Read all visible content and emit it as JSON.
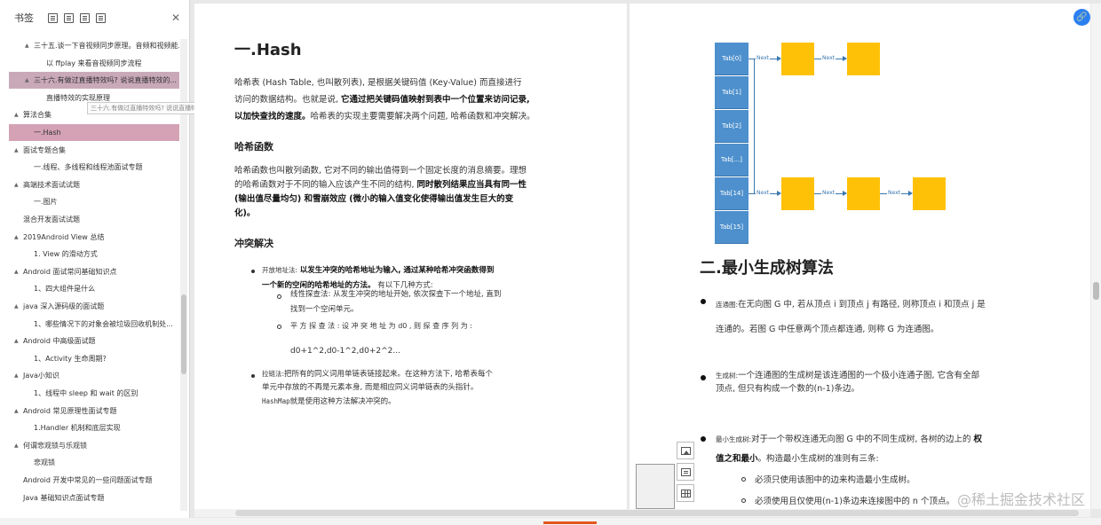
{
  "sidebar": {
    "title": "书签",
    "tooltip": "三十六.有做过直播特效吗? 说说直播特效的实现原",
    "items": [
      {
        "label": "三十五.谈一下音视频同步原理。音频和视频能...",
        "level": 1,
        "twisty": "▲"
      },
      {
        "label": "以 ffplay 来看音视频同步流程",
        "level": 3,
        "twisty": ""
      },
      {
        "label": "三十六.有做过直播特效吗? 说说直播特效的...",
        "level": 1,
        "twisty": "▲"
      },
      {
        "label": "直播特效的实现原理",
        "level": 3,
        "twisty": ""
      },
      {
        "label": "算法合集",
        "level": 0,
        "twisty": "▲"
      },
      {
        "label": "一.Hash",
        "level": 2,
        "twisty": ""
      },
      {
        "label": "面试专题合集",
        "level": 0,
        "twisty": "▲"
      },
      {
        "label": "一.线程、多线程和线程池面试专题",
        "level": 2,
        "twisty": ""
      },
      {
        "label": "高端技术面试试题",
        "level": 0,
        "twisty": "▲"
      },
      {
        "label": "一.图片",
        "level": 2,
        "twisty": ""
      },
      {
        "label": "混合开发面试试题",
        "level": 0,
        "twisty": ""
      },
      {
        "label": "2019Android View 总结",
        "level": 0,
        "twisty": "▲"
      },
      {
        "label": "1. View 的滑动方式",
        "level": 2,
        "twisty": ""
      },
      {
        "label": "Android 面试常问基础知识点",
        "level": 0,
        "twisty": "▲"
      },
      {
        "label": "1、四大组件是什么",
        "level": 2,
        "twisty": ""
      },
      {
        "label": "java 深入源码级的面试题",
        "level": 0,
        "twisty": "▲"
      },
      {
        "label": "1、哪些情况下的对象会被垃圾回收机制处...",
        "level": 2,
        "twisty": ""
      },
      {
        "label": "Android 中高级面试题",
        "level": 0,
        "twisty": "▲"
      },
      {
        "label": "1、Activity 生命周期?",
        "level": 2,
        "twisty": ""
      },
      {
        "label": "Java小知识",
        "level": 0,
        "twisty": "▲"
      },
      {
        "label": "1、线程中 sleep 和 wait 的区别",
        "level": 2,
        "twisty": ""
      },
      {
        "label": "Android 常见原理性面试专题",
        "level": 0,
        "twisty": "▲"
      },
      {
        "label": "1.Handler 机制和底层实现",
        "level": 2,
        "twisty": ""
      },
      {
        "label": "何谓悲观锁与乐观锁",
        "level": 0,
        "twisty": "▲"
      },
      {
        "label": "悲观锁",
        "level": 2,
        "twisty": ""
      },
      {
        "label": "Android 开发中常见的一些问题面试专题",
        "level": 0,
        "twisty": ""
      },
      {
        "label": "Java 基础知识点面试专题",
        "level": 0,
        "twisty": ""
      }
    ]
  },
  "left_page": {
    "heading": "一.Hash",
    "intro_1": "哈希表 (Hash Table, 也叫散列表), 是根据关键码值 (Key-Value) 而直接进行",
    "intro_2a": "访问的数据结构。也就是说, ",
    "intro_2b": "它通过把关键码值映射到表中一个位置来访问记录,",
    "intro_3a": "以加快查找的速度。",
    "intro_3b": "哈希表的实现主要需要解决两个问题, 哈希函数和冲突解决。",
    "sub1": "哈希函数",
    "hf_1": "哈希函数也叫散列函数, 它对不同的输出值得到一个固定长度的消息摘要。理想",
    "hf_2a": "的哈希函数对于不同的输入应该产生不同的结构, ",
    "hf_2b": "同时散列结果应当具有同一性",
    "hf_3": "(输出值尽量均匀) 和雪崩效应 (微小的输入值变化使得输出值发生巨大的变",
    "hf_4": "化)。",
    "sub2": "冲突解决",
    "open_addr_label": "开放地址法:",
    "open_addr_1": "以发生冲突的哈希地址为输入, 通过某种哈希冲突函数得到",
    "open_addr_2a": "一个新的空闲的哈希地址的方法。",
    "open_addr_2b": "有以下几种方式:",
    "linear_1": "线性探查法: 从发生冲突的地址开始, 依次探查下一个地址, 直到",
    "linear_2": "找到一个空闲单元。",
    "square_1": "平 方 探 查 法 :   设 冲 突 地 址 为   d0 ,   则 探 查 序 列 为 :",
    "square_2": "d0+1^2,d0-1^2,d0+2^2...",
    "chain_label": "拉链法:",
    "chain_1": "把所有的同义词用单链表链接起来。在这种方法下, 哈希表每个",
    "chain_2": "单元中存放的不再是元素本身, 而是相应同义词单链表的头指针。",
    "chain_3a": "HashMap",
    "chain_3b": "就是使用这种方法解决冲突的。"
  },
  "hash_diagram": {
    "tabs": [
      "Tab[0]",
      "Tab[1]",
      "Tab[2]",
      "Tab[...]",
      "Tab[14]",
      "Tab[15]"
    ],
    "next_label": "Next",
    "colors": {
      "tab": "#4e90cd",
      "node": "#ffc107"
    }
  },
  "right_page": {
    "heading": "二.最小生成树算法",
    "conn_label": "连通图:",
    "conn_1": "在无向图 G 中, 若从顶点 i 到顶点 j 有路径, 则称顶点 i 和顶点 j 是",
    "conn_2": "连通的。若图 G 中任意两个顶点都连通, 则称 G 为连通图。",
    "span_label": "生成树:",
    "span_1": "一个连通图的生成树是该连通图的一个极小连通子图, 它含有全部",
    "span_2": "顶点, 但只有构成一个数的(n-1)条边。",
    "mst_label": "最小生成树:",
    "mst_1a": "对于一个带权连通无向图 G 中的不同生成树, 各树的边上的 ",
    "mst_1b": "权",
    "mst_2a": "值之和最小",
    "mst_2b": "。构造最小生成树的准则有三条:",
    "rule_1": "必须只使用该图中的边来构造最小生成树。",
    "rule_2": "必须使用且仅使用(n-1)条边来连接图中的 n 个顶点。"
  },
  "watermark": "@稀土掘金技术社区",
  "fab_icon": "link-icon"
}
